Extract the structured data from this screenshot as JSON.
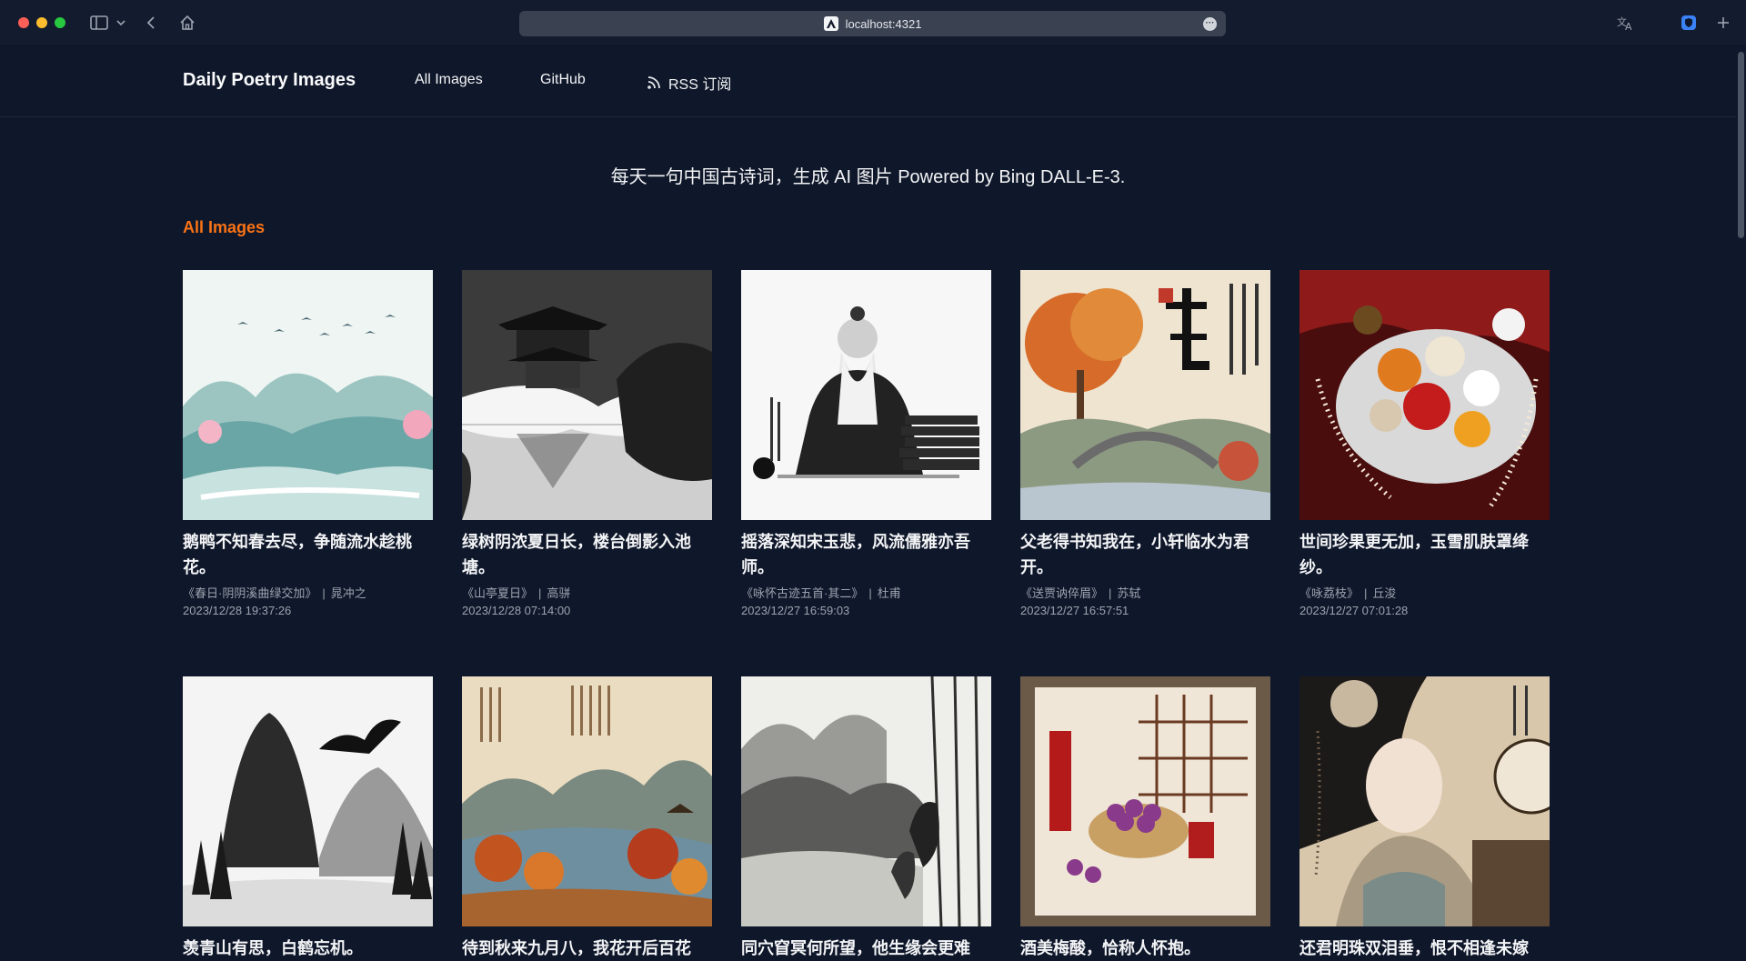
{
  "browser": {
    "url": "localhost:4321"
  },
  "site": {
    "brand": "Daily Poetry Images",
    "nav": [
      "All Images",
      "GitHub",
      "RSS 订阅"
    ]
  },
  "main": {
    "tagline": "每天一句中国古诗词，生成 AI 图片 Powered by Bing DALL-E-3.",
    "section_title": "All Images",
    "cards": [
      {
        "title": "鹅鸭不知春去尽，争随流水趁桃花。",
        "source": "《春日·阴阴溪曲绿交加》",
        "author": "晁冲之",
        "date": "2023/12/28 19:37:26"
      },
      {
        "title": "绿树阴浓夏日长，楼台倒影入池塘。",
        "source": "《山亭夏日》",
        "author": "高骈",
        "date": "2023/12/28 07:14:00"
      },
      {
        "title": "摇落深知宋玉悲，风流儒雅亦吾师。",
        "source": "《咏怀古迹五首·其二》",
        "author": "杜甫",
        "date": "2023/12/27 16:59:03"
      },
      {
        "title": "父老得书知我在，小轩临水为君开。",
        "source": "《送贾讷倅眉》",
        "author": "苏轼",
        "date": "2023/12/27 16:57:51"
      },
      {
        "title": "世间珍果更无加，玉雪肌肤罩绛纱。",
        "source": "《咏荔枝》",
        "author": "丘浚",
        "date": "2023/12/27 07:01:28"
      },
      {
        "title": "羡青山有思，白鹤忘机。",
        "source": "",
        "author": "",
        "date": ""
      },
      {
        "title": "待到秋来九月八，我花开后百花",
        "source": "",
        "author": "",
        "date": ""
      },
      {
        "title": "同穴窅冥何所望，他生缘会更难",
        "source": "",
        "author": "",
        "date": ""
      },
      {
        "title": "酒美梅酸，恰称人怀抱。",
        "source": "",
        "author": "",
        "date": ""
      },
      {
        "title": "还君明珠双泪垂，恨不相逢未嫁",
        "source": "",
        "author": "",
        "date": ""
      }
    ]
  },
  "colors": {
    "background": "#0f172a",
    "accent": "#f97316",
    "text": "#f3f4f6",
    "muted": "#9ca3af"
  },
  "icons": {
    "sidebar": "sidebar-toggle-icon",
    "chevron": "chevron-down-icon",
    "back": "back-arrow-icon",
    "home": "home-icon",
    "translate": "translate-icon",
    "extension": "shield-extension-icon",
    "new_tab": "plus-icon",
    "rss": "rss-icon"
  }
}
